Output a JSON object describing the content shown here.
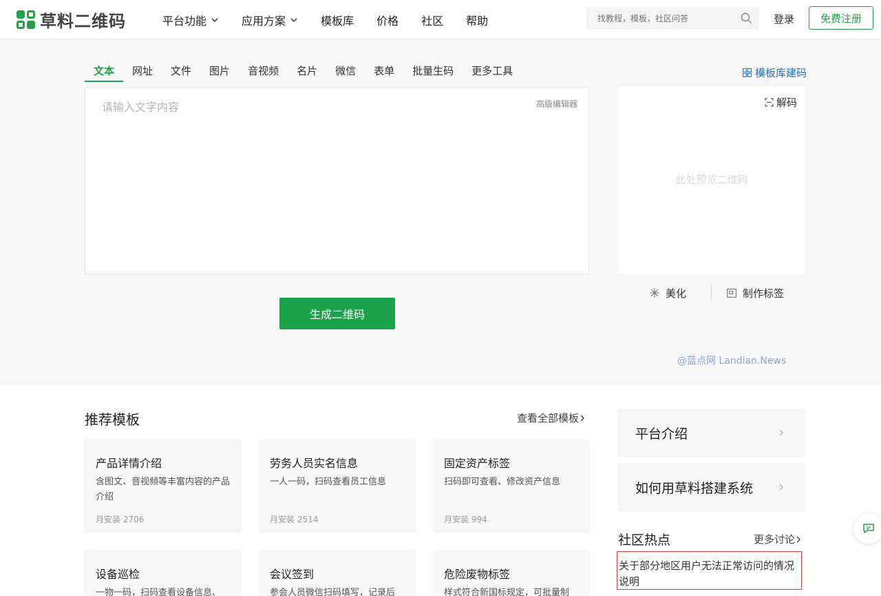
{
  "header": {
    "logo_text": "草料二维码",
    "nav": [
      {
        "label": "平台功能",
        "has_dropdown": true
      },
      {
        "label": "应用方案",
        "has_dropdown": true
      },
      {
        "label": "模板库",
        "has_dropdown": false
      },
      {
        "label": "价格",
        "has_dropdown": false
      },
      {
        "label": "社区",
        "has_dropdown": false
      },
      {
        "label": "帮助",
        "has_dropdown": false
      }
    ],
    "search_placeholder": "找教程，模板，社区问答",
    "login_label": "登录",
    "register_label": "免费注册"
  },
  "generator": {
    "tabs": [
      "文本",
      "网址",
      "文件",
      "图片",
      "音视频",
      "名片",
      "微信",
      "表单",
      "批量生码",
      "更多工具"
    ],
    "active_tab": "文本",
    "template_link": "模板库建码",
    "editor_placeholder": "请输入文字内容",
    "advanced_editor": "高级编辑器",
    "generate_button": "生成二维码",
    "preview_hint": "此处预览二维码",
    "decode_label": "解码",
    "beautify_label": "美化",
    "make_label_label": "制作标签",
    "watermark": "@蓝点网 Landian.News"
  },
  "templates": {
    "title": "推荐模板",
    "view_all": "查看全部模板",
    "cards": [
      {
        "title": "产品详情介绍",
        "desc": "含图文、音视频等丰富内容的产品介绍",
        "stat": "月安装 2706"
      },
      {
        "title": "劳务人员实名信息",
        "desc": "一人一码，扫码查看员工信息",
        "stat": "月安装 2514"
      },
      {
        "title": "固定资产标签",
        "desc": "扫码即可查看、修改资产信息",
        "stat": "月安装 994"
      },
      {
        "title": "设备巡检",
        "desc": "一物一码，扫码查看设备信息、",
        "stat": ""
      },
      {
        "title": "会议签到",
        "desc": "参会人员微信扫码填写，记录后",
        "stat": ""
      },
      {
        "title": "危险废物标签",
        "desc": "样式符合新国标规定，可批量制",
        "stat": ""
      }
    ]
  },
  "sidebar": {
    "platform_intro": "平台介绍",
    "how_to_build": "如何用草料搭建系统",
    "hot_title": "社区热点",
    "more_discuss": "更多讨论",
    "hot_items": [
      "关于部分地区用户无法正常访问的情况说明"
    ]
  },
  "colors": {
    "brand_green": "#1aa34a",
    "link_blue": "#2a6ed1",
    "highlight_red": "#e04040"
  }
}
